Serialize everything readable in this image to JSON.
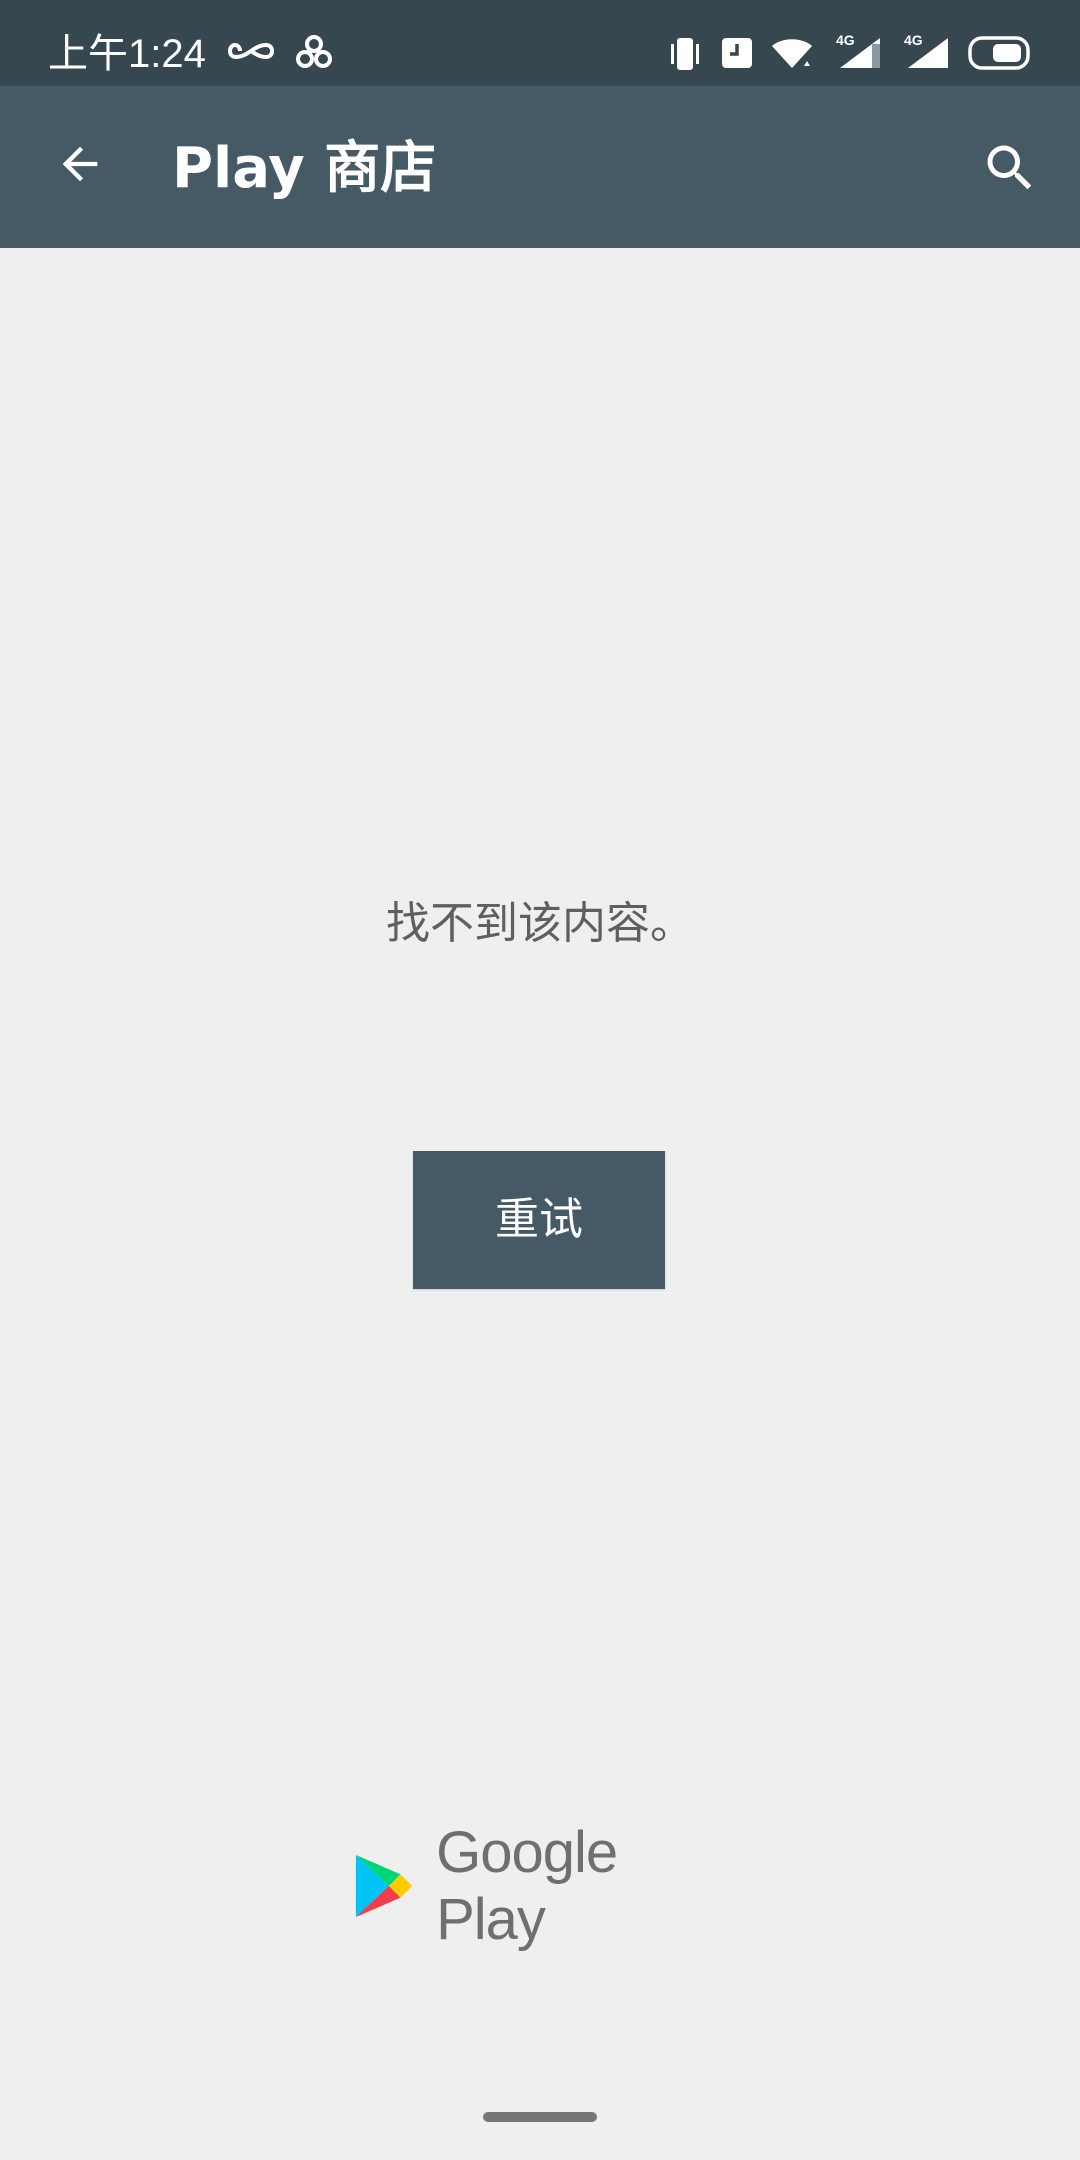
{
  "status_bar": {
    "time": "上午1:24",
    "network_badges": [
      "4G",
      "4G"
    ],
    "icons": [
      "infinity-icon",
      "link-icon",
      "vibrate-icon",
      "clock-notification-icon",
      "wifi-icon",
      "signal-icon",
      "signal-icon",
      "battery-icon"
    ]
  },
  "app_bar": {
    "title": "Play 商店",
    "back_icon": "arrow-back-icon",
    "search_icon": "search-icon"
  },
  "content": {
    "message": "找不到该内容。",
    "retry_label": "重试"
  },
  "footer": {
    "logo_text": "Google Play",
    "logo_icon": "google-play-icon"
  },
  "colors": {
    "status_bar": "#37474f",
    "app_bar": "#455a64",
    "background": "#efefef",
    "button": "#455a64",
    "message_text": "#5f5f5f"
  }
}
